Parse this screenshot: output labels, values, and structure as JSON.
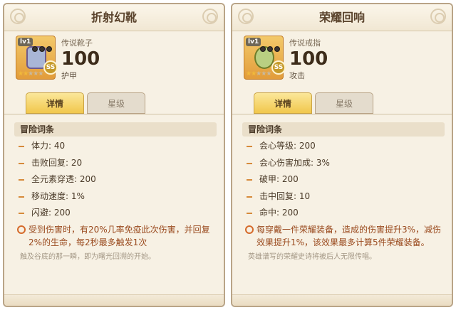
{
  "cards": [
    {
      "title": "折射幻靴",
      "item_icon": "boots-icon",
      "level_badge": "lv1",
      "quality_badge": "SS",
      "stars_filled": 2,
      "stars_total": 5,
      "item_type": "传说靴子",
      "value": "100",
      "stat_type": "护甲",
      "tabs": {
        "details": "详情",
        "stars": "星级"
      },
      "section_title": "冒险词条",
      "stats": [
        "体力: 40",
        "击败回复: 20",
        "全元素穿透: 200",
        "移动速度: 1%",
        "闪避: 200"
      ],
      "effect": "受到伤害时，有20%几率免疫此次伤害，并回复2%的生命，每2秒最多触发1次",
      "flavor": "触及谷底的那一瞬，即为曙光回溯的开始。"
    },
    {
      "title": "荣耀回响",
      "item_icon": "ring-icon",
      "level_badge": "lv1",
      "quality_badge": "SS",
      "stars_filled": 2,
      "stars_total": 5,
      "item_type": "传说戒指",
      "value": "100",
      "stat_type": "攻击",
      "tabs": {
        "details": "详情",
        "stars": "星级"
      },
      "section_title": "冒险词条",
      "stats": [
        "会心等级: 200",
        "会心伤害加成: 3%",
        "破甲: 200",
        "击中回复: 10",
        "命中: 200"
      ],
      "effect": "每穿戴一件荣耀装备，造成的伤害提升3%，减伤效果提升1%，该效果最多计算5件荣耀装备。",
      "flavor": "英雄谱写的荣耀史诗将被后人无限传唱。"
    }
  ],
  "colors": {
    "accent_gold": "#f1c74c",
    "dash_orange": "#d68a3a",
    "effect_text": "#9a4a1e",
    "card_bg": "#f7f1e4"
  }
}
